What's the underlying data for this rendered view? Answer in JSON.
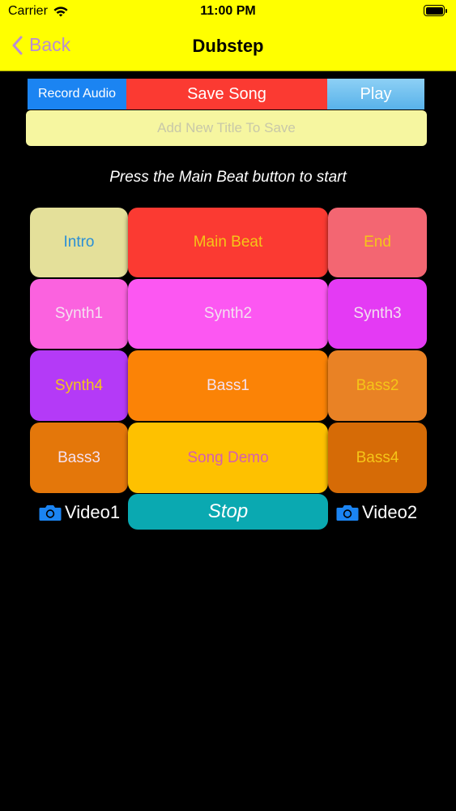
{
  "status_bar": {
    "carrier": "Carrier",
    "time": "11:00 PM"
  },
  "nav": {
    "back_label": "Back",
    "title": "Dubstep"
  },
  "toolbar": {
    "record_label": "Record Audio",
    "save_label": "Save Song",
    "play_label": "Play"
  },
  "title_input": {
    "placeholder": "Add New Title To Save",
    "value": ""
  },
  "instruction": "Press the Main Beat button to start",
  "pads": [
    {
      "label": "Intro",
      "bg": "#e4e09a",
      "fg": "#2a8fd6"
    },
    {
      "label": "Main Beat",
      "bg": "#fb3a32",
      "fg": "#f5c518"
    },
    {
      "label": "End",
      "bg": "#f36672",
      "fg": "#f5c518"
    },
    {
      "label": "Synth1",
      "bg": "#fb62df",
      "fg": "#f4e0f0"
    },
    {
      "label": "Synth2",
      "bg": "#fc57f2",
      "fg": "#f4e0f0"
    },
    {
      "label": "Synth3",
      "bg": "#e43af4",
      "fg": "#f4e0f0"
    },
    {
      "label": "Synth4",
      "bg": "#b43af7",
      "fg": "#f5c518"
    },
    {
      "label": "Bass1",
      "bg": "#fb8306",
      "fg": "#f4e0f0"
    },
    {
      "label": "Bass2",
      "bg": "#e98225",
      "fg": "#f5c518"
    },
    {
      "label": "Bass3",
      "bg": "#e4770a",
      "fg": "#f4e0f0"
    },
    {
      "label": "Song Demo",
      "bg": "#fec100",
      "fg": "#d55fb0"
    },
    {
      "label": "Bass4",
      "bg": "#d66b06",
      "fg": "#f5c518"
    }
  ],
  "video1_label": "Video1",
  "video2_label": "Video2",
  "stop_label": "Stop",
  "colors": {
    "header_bg": "#ffff00",
    "back_accent": "#b98ed2",
    "camera_icon": "#1b84f2"
  },
  "icons": {
    "back": "chevron-left-icon",
    "camera": "camera-icon",
    "wifi": "wifi-icon",
    "battery": "battery-icon"
  }
}
